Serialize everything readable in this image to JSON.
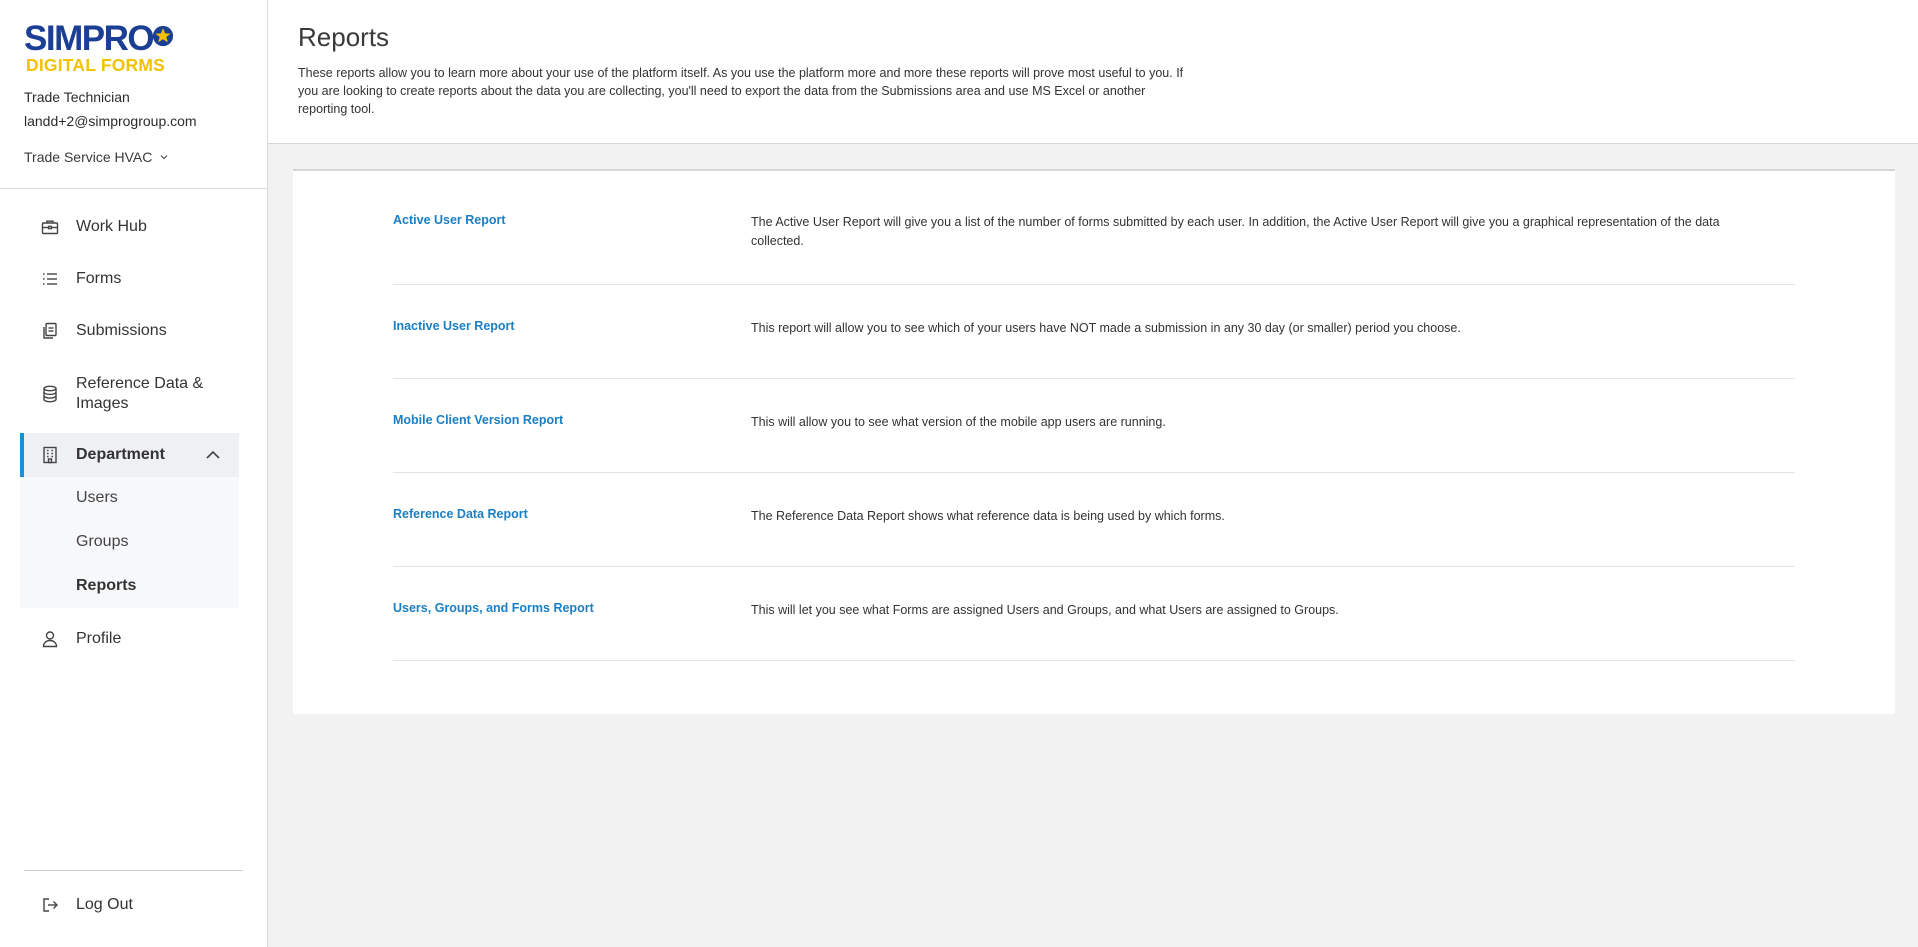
{
  "brand": {
    "top": "SIMPRO",
    "bottom": "DIGITAL FORMS",
    "colors": {
      "blue": "#1b3f94",
      "yellow": "#f2c200"
    }
  },
  "user": {
    "role": "Trade Technician",
    "email": "landd+2@simprogroup.com",
    "company": "Trade Service HVAC"
  },
  "nav": {
    "work_hub": "Work Hub",
    "forms": "Forms",
    "submissions": "Submissions",
    "reference_data": "Reference Data & Images",
    "department": "Department",
    "department_items": [
      "Users",
      "Groups",
      "Reports"
    ],
    "profile": "Profile",
    "logout": "Log Out"
  },
  "header": {
    "title": "Reports",
    "description": "These reports allow you to learn more about your use of the platform itself. As you use the platform more and more these reports will prove most useful to you. If you are looking to create reports about the data you are collecting, you'll need to export the data from the Submissions area and use MS Excel or another reporting tool."
  },
  "reports": [
    {
      "name": "Active User Report",
      "description": "The Active User Report will give you a list of the number of forms submitted by each user. In addition, the Active User Report will give you a graphical representation of the data collected."
    },
    {
      "name": "Inactive User Report",
      "description": "This report will allow you to see which of your users have NOT made a submission in any 30 day (or smaller) period you choose."
    },
    {
      "name": "Mobile Client Version Report",
      "description": "This will allow you to see what version of the mobile app users are running."
    },
    {
      "name": "Reference Data Report",
      "description": "The Reference Data Report shows what reference data is being used by which forms."
    },
    {
      "name": "Users, Groups, and Forms Report",
      "description": "This will let you see what Forms are assigned Users and Groups, and what Users are assigned to Groups."
    }
  ],
  "colors": {
    "accent": "#1a91d6",
    "link": "#1a7fc4"
  }
}
